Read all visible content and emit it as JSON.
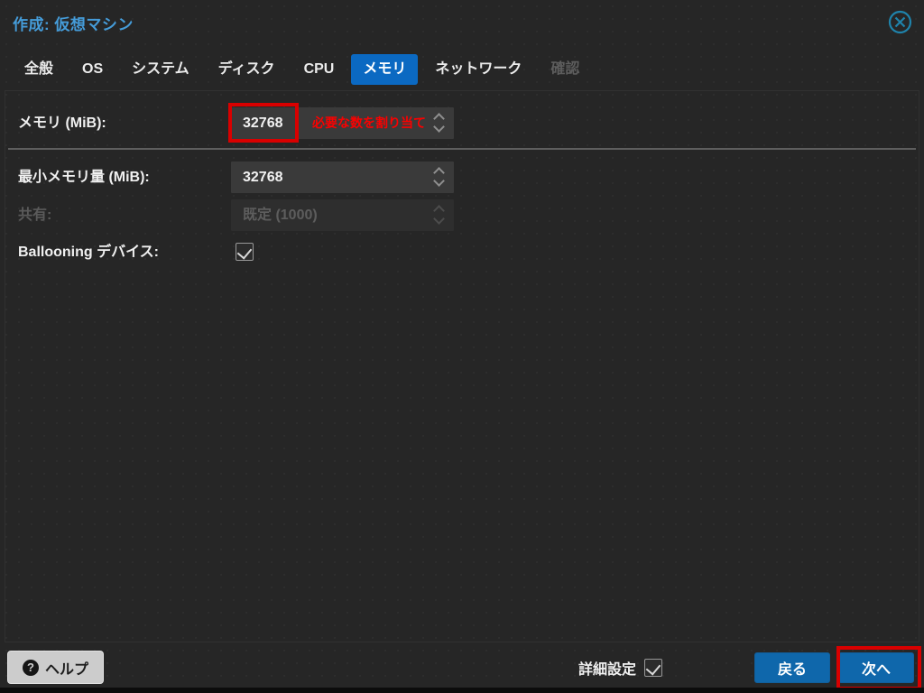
{
  "dialog": {
    "title": "作成: 仮想マシン"
  },
  "tabs": [
    {
      "label": "全般",
      "state": "normal"
    },
    {
      "label": "OS",
      "state": "normal"
    },
    {
      "label": "システム",
      "state": "normal"
    },
    {
      "label": "ディスク",
      "state": "normal"
    },
    {
      "label": "CPU",
      "state": "normal"
    },
    {
      "label": "メモリ",
      "state": "active"
    },
    {
      "label": "ネットワーク",
      "state": "normal"
    },
    {
      "label": "確認",
      "state": "disabled"
    }
  ],
  "form": {
    "memory": {
      "label": "メモリ (MiB):",
      "value": "32768",
      "validation_message": "必要な数を割り当て",
      "annotated": true
    },
    "min_memory": {
      "label": "最小メモリ量 (MiB):",
      "value": "32768"
    },
    "shares": {
      "label": "共有:",
      "value": "既定 (1000)",
      "disabled": true
    },
    "ballooning": {
      "label": "Ballooning デバイス:",
      "checked": true
    }
  },
  "footer": {
    "help_label": "ヘルプ",
    "help_icon_glyph": "?",
    "advanced_label": "詳細設定",
    "advanced_checked": true,
    "back_label": "戻る",
    "next_label": "次へ",
    "next_annotated": true
  },
  "colors": {
    "accent_tab_blue": "#0b69c2",
    "button_blue": "#0f67ab",
    "title_blue": "#459cd9",
    "annotation_red": "#d90000",
    "validation_red": "#fb0000",
    "close_icon_teal": "#1f83ab"
  }
}
